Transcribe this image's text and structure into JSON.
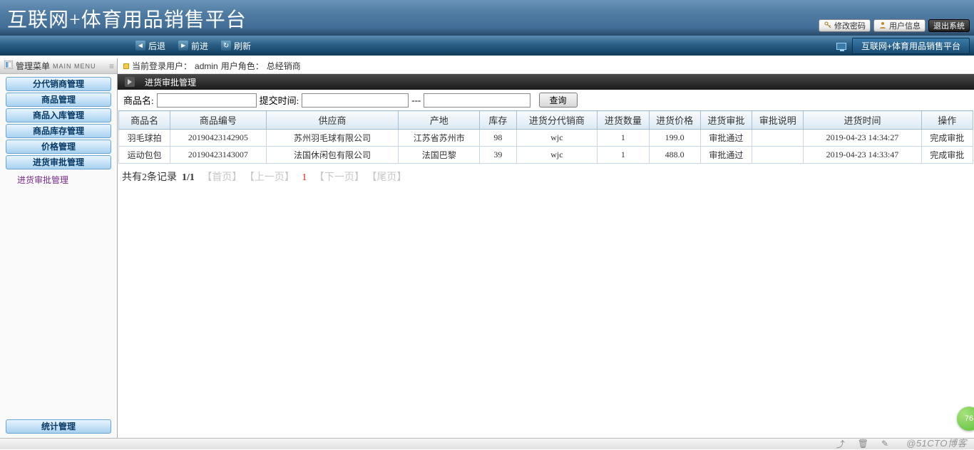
{
  "banner": {
    "title": "互联网+体育用品销售平台",
    "buttons": {
      "change_pw": "修改密码",
      "user_info": "用户信息",
      "logout": "退出系统"
    }
  },
  "toolbar": {
    "back": "后退",
    "forward": "前进",
    "refresh": "刷新",
    "app_label": "互联网+体育用品销售平台"
  },
  "sidebar": {
    "menu_title": "管理菜单",
    "menu_sub": "MAIN MENU",
    "items": [
      "分代销商管理",
      "商品管理",
      "商品入库管理",
      "商品库存管理",
      "价格管理",
      "进货审批管理"
    ],
    "sub_item": "进货审批管理",
    "bottom_item": "统计管理"
  },
  "info": {
    "prefix": "当前登录用户：",
    "user": "admin",
    "role_prefix": " 用户角色：",
    "role": "总经销商"
  },
  "section": {
    "title": "进货审批管理"
  },
  "filter": {
    "name_label": "商品名:",
    "time_label": "提交时间:",
    "sep": "---",
    "query": "查询"
  },
  "table": {
    "headers": [
      "商品名",
      "商品编号",
      "供应商",
      "产地",
      "库存",
      "进货分代销商",
      "进货数量",
      "进货价格",
      "进货审批",
      "审批说明",
      "进货时间",
      "操作"
    ],
    "rows": [
      {
        "c": [
          "羽毛球拍",
          "20190423142905",
          "苏州羽毛球有限公司",
          "江苏省苏州市",
          "98",
          "wjc",
          "1",
          "199.0",
          "审批通过",
          "",
          "2019-04-23 14:34:27",
          "完成审批"
        ]
      },
      {
        "c": [
          "运动包包",
          "20190423143007",
          "法国休闲包有限公司",
          "法国巴黎",
          "39",
          "wjc",
          "1",
          "488.0",
          "审批通过",
          "",
          "2019-04-23 14:33:47",
          "完成审批"
        ]
      }
    ]
  },
  "pager": {
    "total_text": "共有2条记录",
    "page_text": "1/1",
    "first": "【首页】",
    "prev": "【上一页】",
    "current": "1",
    "next": "【下一页】",
    "last": "【尾页】"
  },
  "badge": "76",
  "watermark": "@51CTO博客"
}
